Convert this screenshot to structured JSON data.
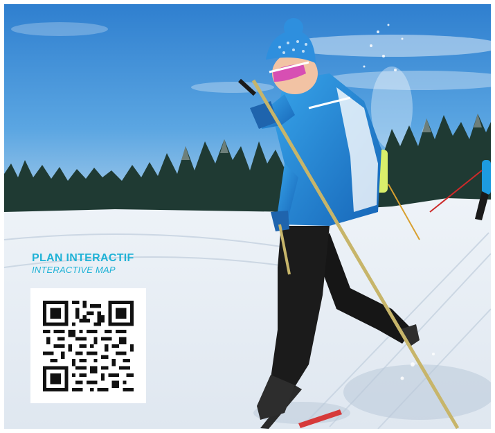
{
  "caption": {
    "title": "PLAN INTERACTIF",
    "subtitle": "INTERACTIVE MAP"
  },
  "colors": {
    "accent": "#1fb2d6",
    "sky": "#3f8fd6",
    "snow": "#f4f7fb",
    "forest": "#1f3a33",
    "jacket": "#1e88d8"
  },
  "qr": {
    "icon": "qr-code-icon"
  }
}
